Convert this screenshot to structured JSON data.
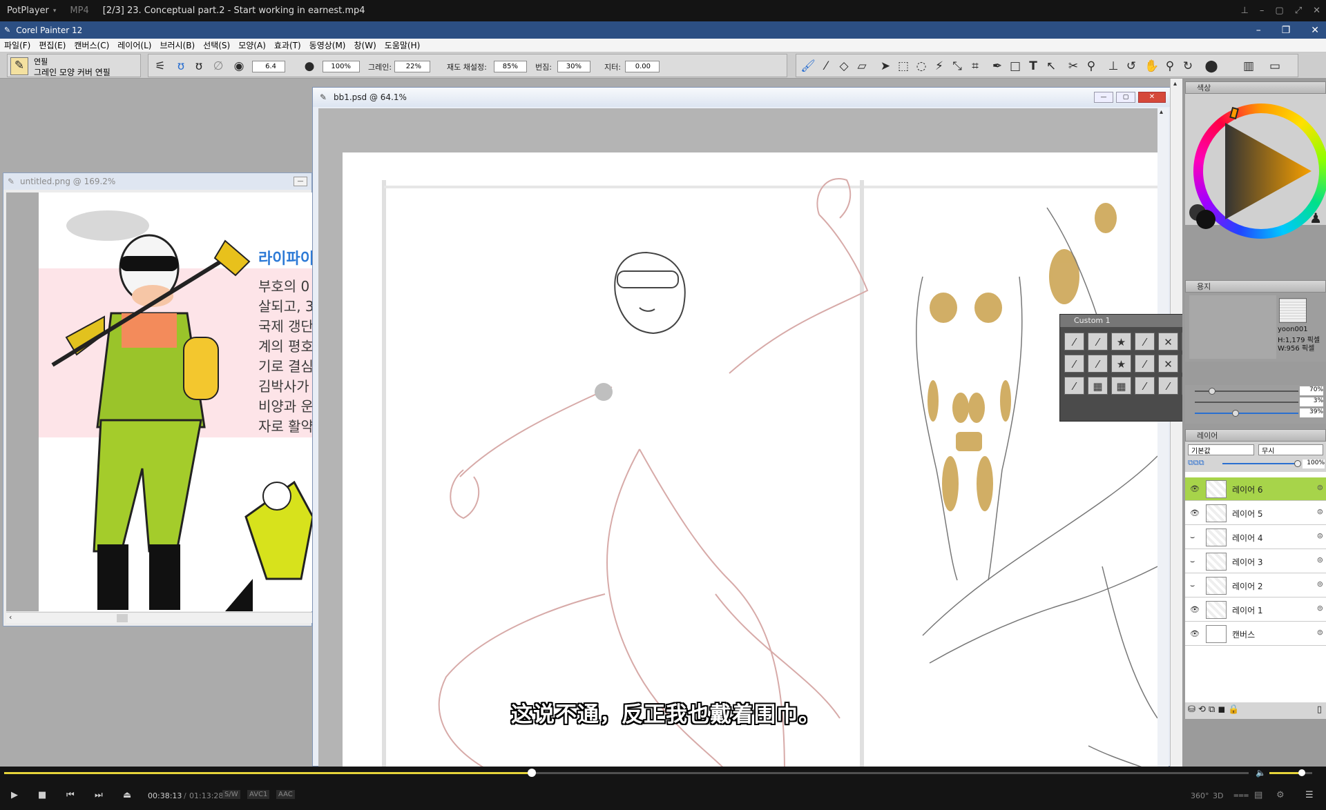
{
  "player": {
    "brand": "PotPlayer",
    "format": "MP4",
    "title": "[2/3] 23. Conceptual part.2 - Start working in earnest.mp4",
    "time_current": "00:38:13",
    "time_sep": "/",
    "time_total": "01:13:28",
    "tag_sw": "S/W",
    "tag_video": "AVC1",
    "tag_audio": "AAC",
    "progress": 0.424,
    "volume": 0.75,
    "subtitle": "这说不通，反正我也戴着围巾。",
    "right_tags": [
      "360°",
      "3D"
    ]
  },
  "app": {
    "title": "Corel Painter 12",
    "menu": [
      "파일(F)",
      "편집(E)",
      "캔버스(C)",
      "레이어(L)",
      "브러시(B)",
      "선택(S)",
      "모양(A)",
      "효과(T)",
      "동영상(M)",
      "창(W)",
      "도움말(H)"
    ]
  },
  "toolbar": {
    "brush_category": "연필",
    "brush_variant": "그레인 모양 커버 연필",
    "size_value": "6.4",
    "opacity_value": "100%",
    "grain_label": "그레인:",
    "grain_value": "22%",
    "resat_label": "재도 채설정:",
    "resat_value": "85%",
    "bleed_label": "번짐:",
    "bleed_value": "30%",
    "jitter_label": "지터:",
    "jitter_value": "0.00"
  },
  "windows": {
    "small_title": "untitled.png @ 169.2%",
    "small_heading": "라이파이",
    "small_text": [
      "부호의 0",
      "살되고, 3",
      "국제 갱단",
      "계의 평호",
      "기로 결심",
      "김박사가",
      "비양과 운",
      "자로 활약"
    ],
    "main_title": "bb1.psd @ 64.1%"
  },
  "panels": {
    "color_label": "색상",
    "paper_label": "용지",
    "paper_name": "yoon001",
    "paper_h": "H:1,179 픽셀",
    "paper_w": "W:956 픽셀",
    "slider1": "70%",
    "slider2": "3%",
    "slider3": "39%",
    "layers_label": "레이어",
    "composite": "기본값",
    "composite2": "무시",
    "layer_opacity": "100%",
    "layers": [
      "레이어 6",
      "레이어 5",
      "레이어 4",
      "레이어 3",
      "레이어 2",
      "레이어 1",
      "캔버스"
    ],
    "active_layer_color": "#a7d44a",
    "custom_palette_title": "Custom 1"
  }
}
